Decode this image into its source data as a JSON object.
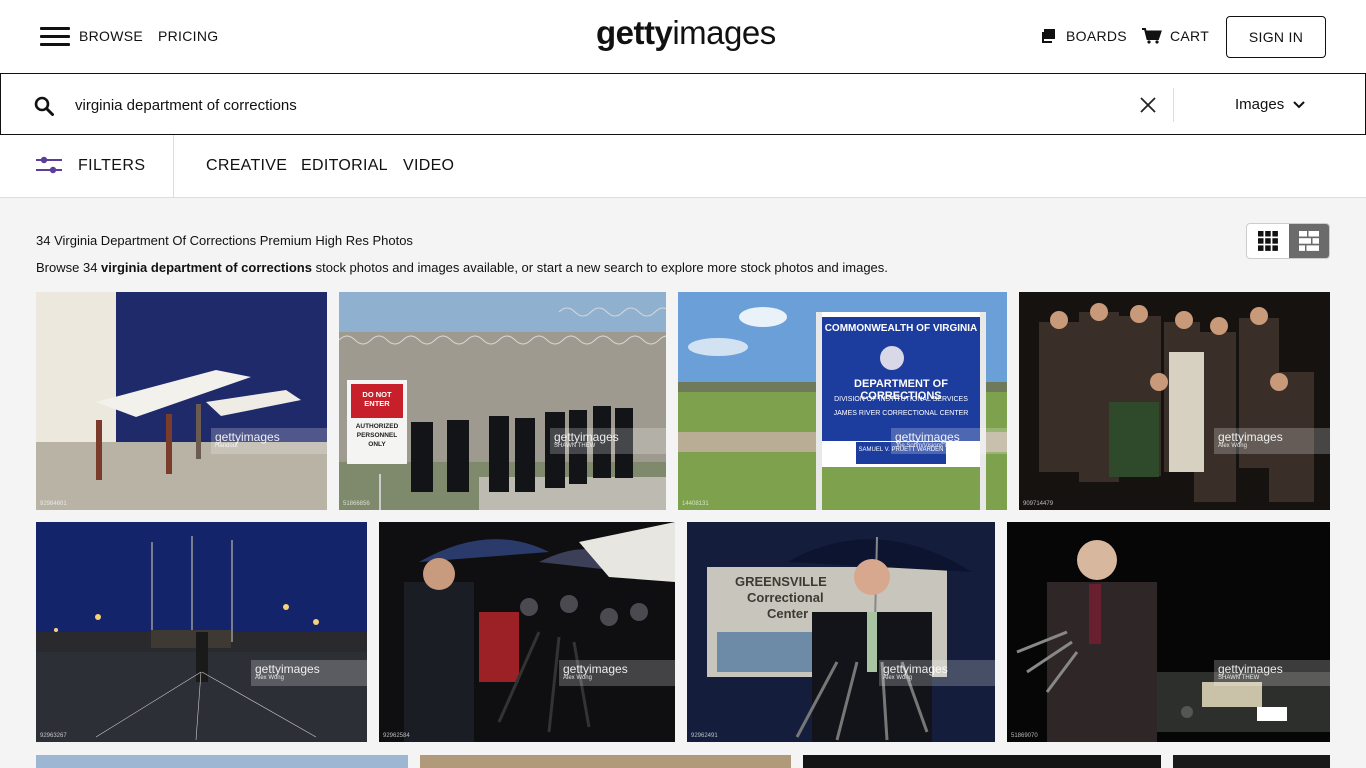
{
  "header": {
    "nav": {
      "browse": "BROWSE",
      "pricing": "PRICING"
    },
    "logo": {
      "bold": "getty",
      "light": "images"
    },
    "boards": "BOARDS",
    "cart": "CART",
    "signin": "SIGN IN"
  },
  "search": {
    "query": "virginia department of corrections",
    "type": "Images"
  },
  "filters": {
    "label": "FILTERS",
    "tabs": [
      "CREATIVE",
      "EDITORIAL",
      "VIDEO"
    ]
  },
  "results": {
    "title": "34 Virginia Department Of Corrections Premium High Res Photos",
    "sub_prefix": "Browse 34 ",
    "sub_query": "virginia department of corrections",
    "sub_suffix": " stock photos and images available, or start a new search to explore more stock photos and images."
  },
  "images": [
    {
      "id": "92984601",
      "watermark": "gettyimages",
      "credit": "Handout"
    },
    {
      "id": "51866856",
      "watermark": "gettyimages",
      "credit": "SHAWN THEW",
      "sign1": "DO NOT ENTER",
      "sign2": "AUTHORIZED PERSONNEL ONLY"
    },
    {
      "id": "14408131",
      "watermark": "gettyimages",
      "credit": "Joe Sohm/Visions of America",
      "sign1": "COMMONWEALTH OF VIRGINIA",
      "sign2": "DEPARTMENT OF CORRECTIONS",
      "sign3": "DIVISION OF INSTITUTIONAL SERVICES",
      "sign4": "JAMES RIVER CORRECTIONAL CENTER",
      "sign5": "SAMUEL V. PRUETT WARDEN"
    },
    {
      "id": "909714479",
      "watermark": "gettyimages",
      "credit": "Alex Wong"
    },
    {
      "id": "92963267",
      "watermark": "gettyimages",
      "credit": "Alex Wong"
    },
    {
      "id": "92962584",
      "watermark": "gettyimages",
      "credit": "Alex Wong"
    },
    {
      "id": "92962491",
      "watermark": "gettyimages",
      "credit": "Alex Wong",
      "sign1": "GREENSVILLE",
      "sign2": "Correctional",
      "sign3": "Center"
    },
    {
      "id": "51869070",
      "watermark": "gettyimages",
      "credit": "SHAWN THEW"
    }
  ],
  "colors": {
    "accent": "#5a3d9c",
    "toggle_active": "#6b6b6b"
  }
}
